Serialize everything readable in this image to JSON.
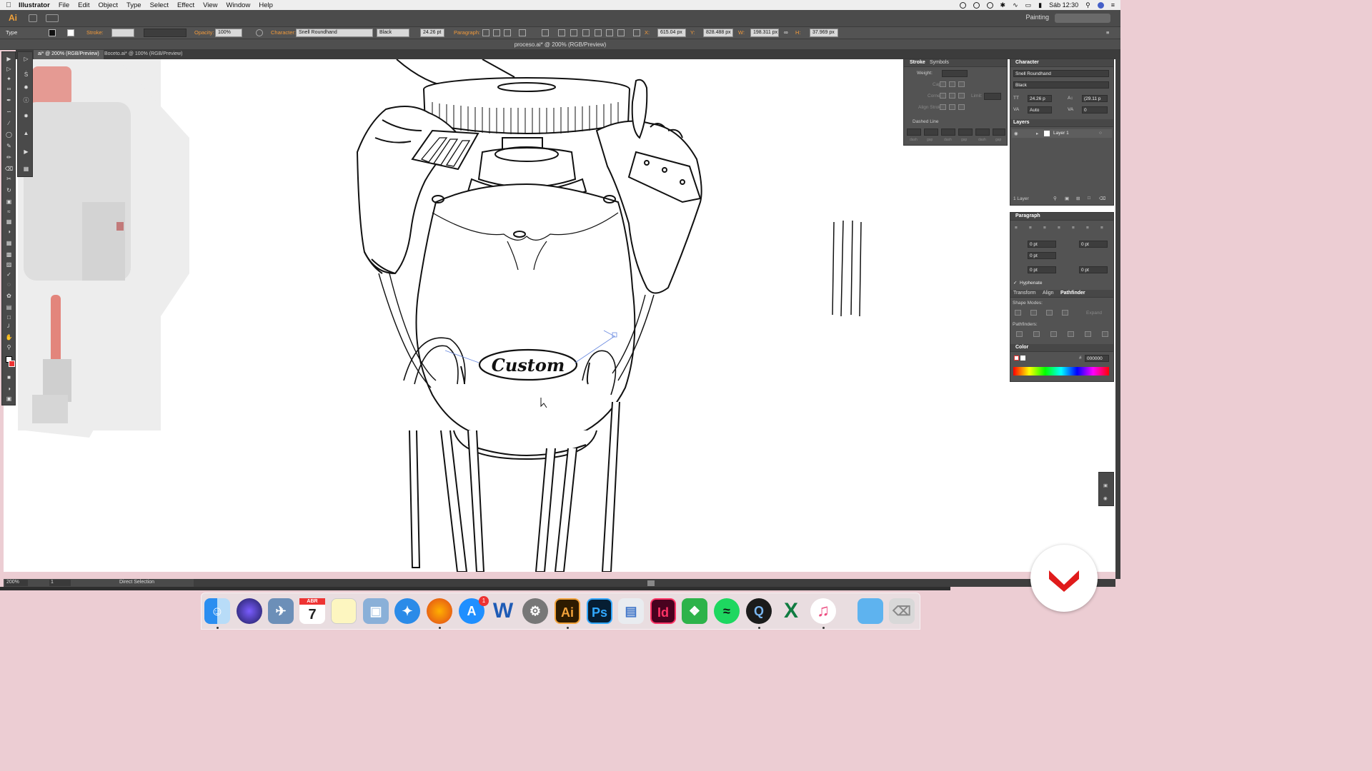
{
  "menubar": {
    "app": "Illustrator",
    "items": [
      "File",
      "Edit",
      "Object",
      "Type",
      "Select",
      "Effect",
      "View",
      "Window",
      "Help"
    ],
    "clock": "Sáb 12:30"
  },
  "appbar": {
    "logo": "Ai",
    "workspace": "Painting"
  },
  "control": {
    "tool_label": "Type",
    "stroke_label": "Stroke:",
    "opacity_label": "Opacity:",
    "opacity_value": "100%",
    "character_label": "Character:",
    "font_value": "Snell Roundhand",
    "style_value": "Black",
    "size_value": "24.26 pt",
    "paragraph_label": "Paragraph:",
    "x_label": "X:",
    "x_value": "615.04 px",
    "y_label": "Y:",
    "y_value": "828.488 px",
    "w_label": "W:",
    "w_value": "198.311 px",
    "h_label": "H:",
    "h_value": "37.969 px"
  },
  "document": {
    "title": "proceso.ai* @ 200% (RGB/Preview)",
    "tabs": [
      {
        "label": "ai* @ 200% (RGB/Preview)",
        "active": true
      },
      {
        "label": "Boceto.ai* @ 100% (RGB/Preview)",
        "active": false
      }
    ]
  },
  "artwork": {
    "label_text": "Custom"
  },
  "status": {
    "zoom": "200%",
    "page": "1",
    "tool_name": "Direct Selection"
  },
  "stroke_panel": {
    "tabs": [
      "Stroke",
      "Symbols"
    ],
    "weight_label": "Weight:",
    "cap_label": "Cap:",
    "corner_label": "Corner:",
    "limit_label": "Limit:",
    "align_label": "Align Stroke:",
    "dashed_label": "Dashed Line",
    "dash_labels": [
      "dash",
      "gap",
      "dash",
      "gap",
      "dash",
      "gap"
    ]
  },
  "character_panel": {
    "title": "Character",
    "font": "Snell Roundhand",
    "style": "Black",
    "size": "24.26 p",
    "leading": "(29.11 p",
    "kerning": "Auto",
    "tracking": "0"
  },
  "layers_panel": {
    "title": "Layers",
    "layer_name": "Layer 1",
    "footer": "1 Layer"
  },
  "paragraph_panel": {
    "title": "Paragraph",
    "indent_left": "0 pt",
    "indent_right": "0 pt",
    "first_line": "0 pt",
    "space_before": "0 pt",
    "space_after": "0 pt",
    "hyphenate": "Hyphenate"
  },
  "pathfinder_panel": {
    "tabs": [
      "Transform",
      "Align",
      "Pathfinder"
    ],
    "shape_modes": "Shape Modes:",
    "expand": "Expand",
    "pathfinders": "Pathfinders:"
  },
  "color_panel": {
    "title": "Color",
    "hex": "000000"
  },
  "dock": {
    "calendar_month": "ABR",
    "calendar_day": "7",
    "appstore_badge": "1",
    "ai_label": "Ai",
    "ps_label": "Ps",
    "id_label": "Id",
    "word_label": "W",
    "excel_label": "X"
  },
  "colors": {
    "accent": "#f29a3b",
    "illustrator": "#f2a23a",
    "brand_red": "#e01b1b",
    "panel_bg": "#535353",
    "canvas_bg": "#ffffff"
  }
}
